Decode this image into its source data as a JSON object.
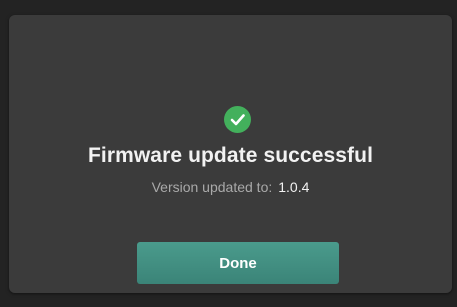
{
  "dialog": {
    "status_icon": "check-circle-icon",
    "title": "Firmware update successful",
    "version_label": "Version updated to:",
    "version_value": "1.0.4",
    "done_label": "Done"
  },
  "colors": {
    "success_green": "#43b05c",
    "button_teal": "#3e8a7c",
    "dialog_background": "#3b3b3b"
  }
}
